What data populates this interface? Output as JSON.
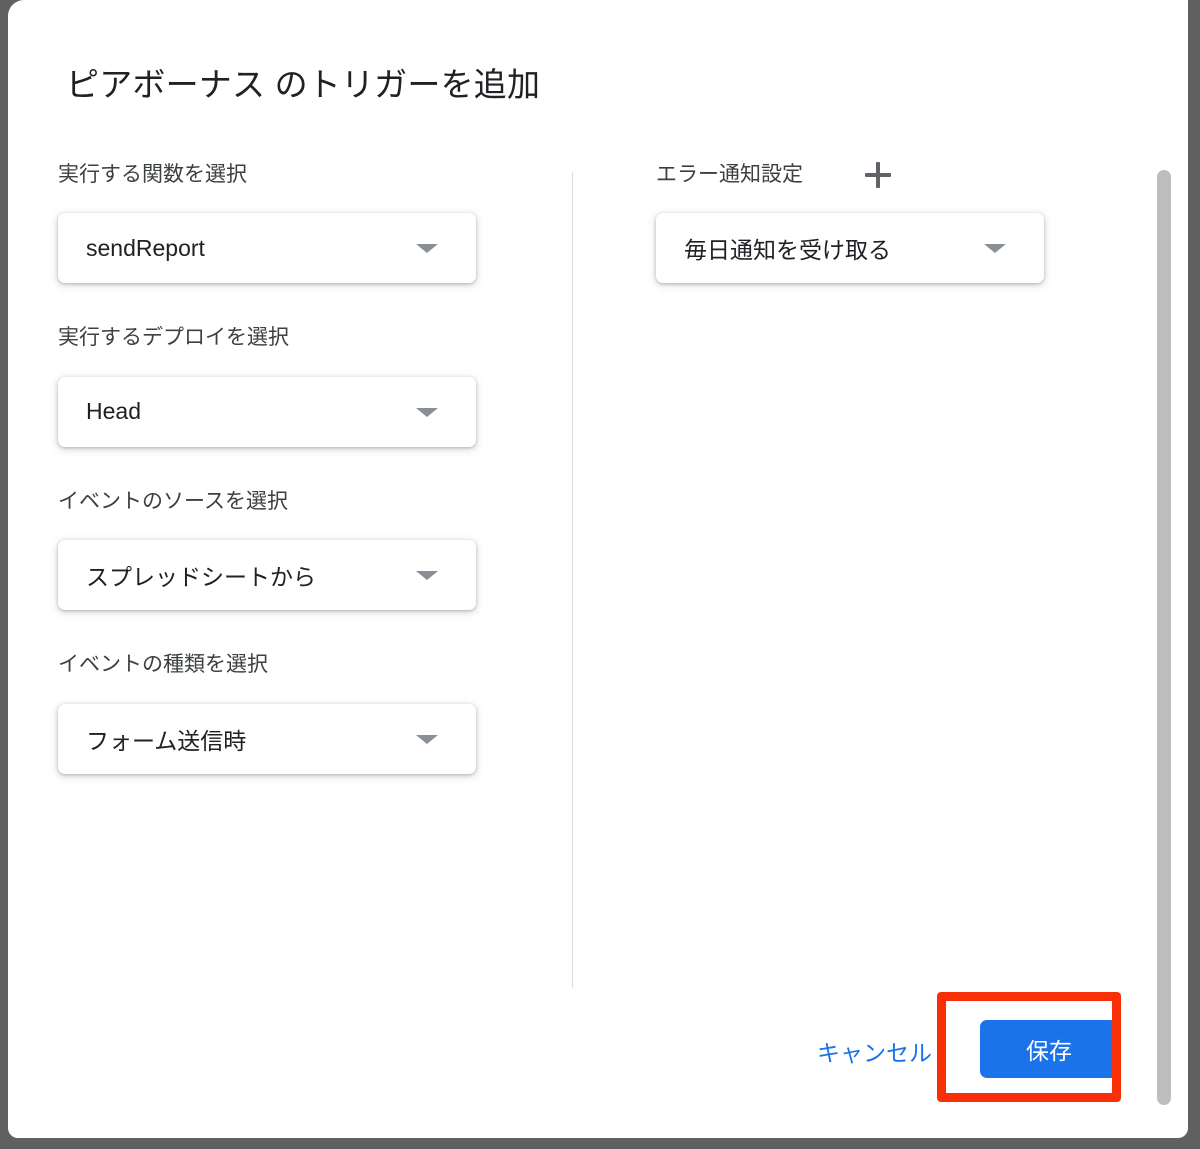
{
  "dialog": {
    "title": "ピアボーナス のトリガーを追加",
    "accent_color": "#1a73e8",
    "highlight_color": "#f82f07"
  },
  "left_column": {
    "fields": [
      {
        "label": "実行する関数を選択",
        "value": "sendReport",
        "arrow_icon": "chevron-down-icon"
      },
      {
        "label": "実行するデプロイを選択",
        "value": "Head",
        "arrow_icon": "chevron-down-icon"
      },
      {
        "label": "イベントのソースを選択",
        "value": "スプレッドシートから",
        "arrow_icon": "chevron-down-icon"
      },
      {
        "label": "イベントの種類を選択",
        "value": "フォーム送信時",
        "arrow_icon": "chevron-down-icon"
      }
    ]
  },
  "right_column": {
    "fields": [
      {
        "label": "エラー通知設定",
        "add_icon": "plus-icon",
        "value": "毎日通知を受け取る",
        "arrow_icon": "chevron-down-icon"
      }
    ]
  },
  "footer": {
    "cancel_label": "キャンセル",
    "save_label": "保存"
  },
  "scrollbar": {
    "name": "vertical-scrollbar"
  }
}
